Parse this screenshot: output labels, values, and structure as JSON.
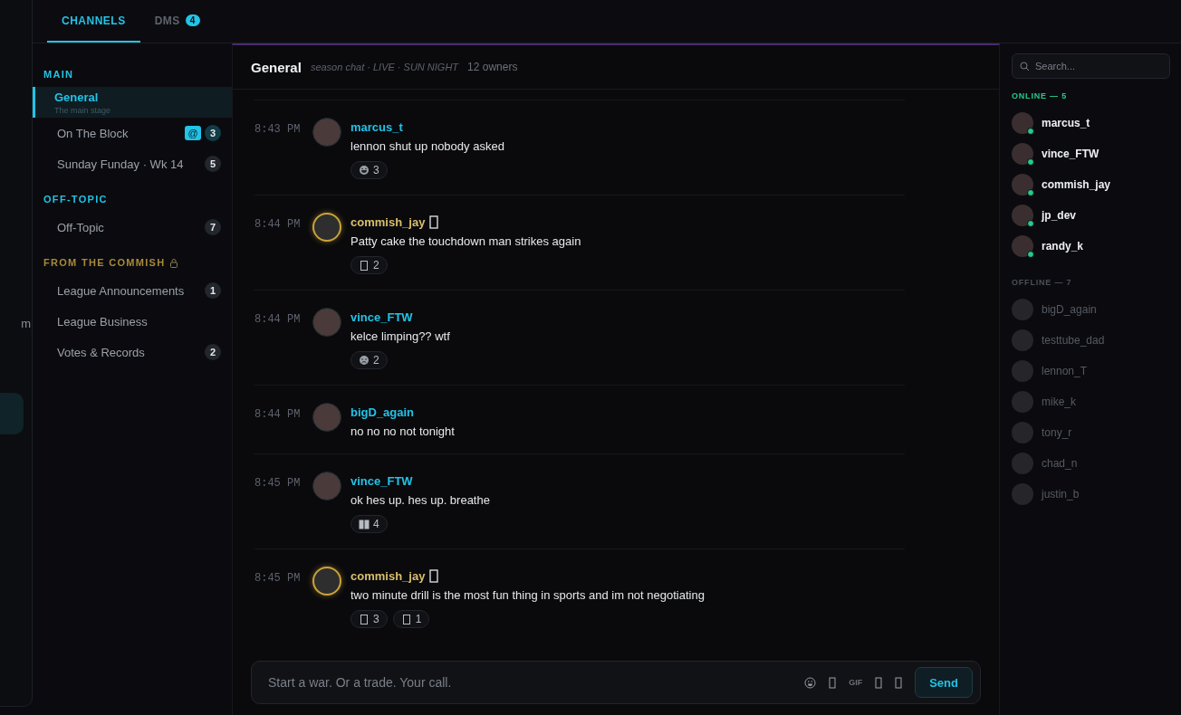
{
  "left_panel": {
    "fragment": "m"
  },
  "tabs": [
    {
      "label": "CHANNELS",
      "selected": true
    },
    {
      "label": "DMS",
      "selected": false,
      "count": "4"
    }
  ],
  "sidebar": {
    "sections": [
      {
        "title": "MAIN",
        "locked": false,
        "channels": [
          {
            "name": "General",
            "subtitle": "The main stage",
            "selected": true
          },
          {
            "name": "On The Block",
            "selected": false,
            "mention": "@",
            "count": "3"
          },
          {
            "name": "Sunday Funday · Wk 14",
            "selected": false,
            "count": "5"
          }
        ]
      },
      {
        "title": "OFF-TOPIC",
        "locked": false,
        "channels": [
          {
            "name": "Off-Topic",
            "selected": false,
            "count": "7"
          }
        ]
      },
      {
        "title": "FROM THE COMMISH",
        "locked": true,
        "channels": [
          {
            "name": "League Announcements",
            "selected": false,
            "count": "1"
          },
          {
            "name": "League Business",
            "selected": false
          },
          {
            "name": "Votes & Records",
            "selected": false,
            "count": "2"
          }
        ]
      }
    ]
  },
  "channel_header": {
    "title": "General",
    "subtitle": "season chat · LIVE · SUN NIGHT",
    "members": "12 owners"
  },
  "messages": [
    {
      "time": "8:43 PM",
      "author": "marcus_t",
      "kind": "member",
      "text": "lennon shut up nobody asked",
      "reactions": [
        {
          "kind": "laugh",
          "count": "3"
        }
      ]
    },
    {
      "time": "8:44 PM",
      "author": "commish_jay",
      "kind": "commish",
      "text": "Patty cake the touchdown man strikes again",
      "reactions": [
        {
          "kind": "missing",
          "count": "2"
        }
      ]
    },
    {
      "time": "8:44 PM",
      "author": "vince_FTW",
      "kind": "member",
      "text": "kelce limping?? wtf",
      "reactions": [
        {
          "kind": "sad",
          "count": "2"
        }
      ]
    },
    {
      "time": "8:44 PM",
      "author": "bigD_again",
      "kind": "member",
      "text": "no no no not tonight"
    },
    {
      "time": "8:45 PM",
      "author": "vince_FTW",
      "kind": "member",
      "text": "ok hes up. hes up. breathe",
      "reactions": [
        {
          "kind": "double",
          "count": "4"
        }
      ]
    },
    {
      "time": "8:45 PM",
      "author": "commish_jay",
      "kind": "commish",
      "text": "two minute drill is the most fun thing in sports and im not negotiating",
      "reactions": [
        {
          "kind": "missing",
          "count": "3"
        },
        {
          "kind": "missing",
          "count": "1"
        }
      ]
    }
  ],
  "composer": {
    "placeholder": "Start a war. Or a trade. Your call.",
    "gif": "GIF",
    "send": "Send"
  },
  "members": {
    "search_placeholder": "Search...",
    "groups": [
      {
        "title": "ONLINE — 5",
        "kind": "online",
        "names": [
          "marcus_t",
          "vince_FTW",
          "commish_jay",
          "jp_dev",
          "randy_k"
        ]
      },
      {
        "title": "OFFLINE — 7",
        "kind": "offline",
        "names": [
          "bigD_again",
          "testtube_dad",
          "lennon_T",
          "mike_k",
          "tony_r",
          "chad_n",
          "justin_b"
        ]
      }
    ]
  }
}
